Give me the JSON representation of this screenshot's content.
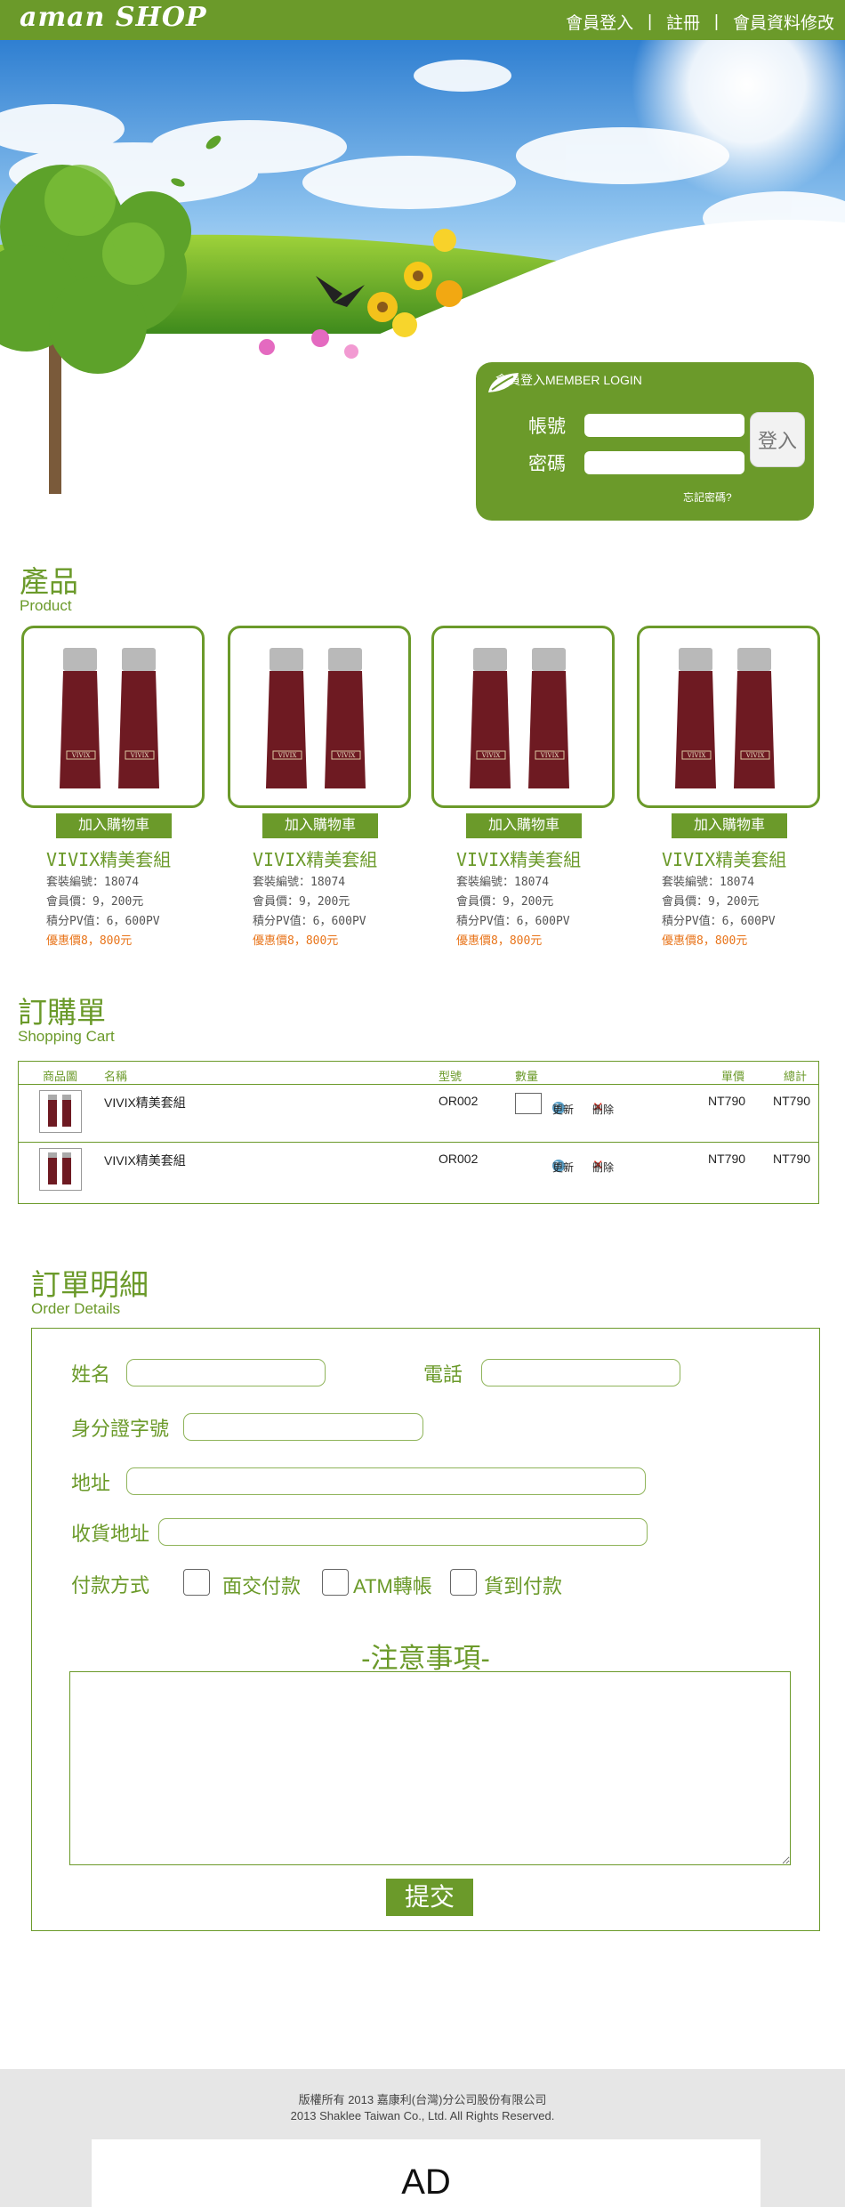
{
  "header": {
    "logo": "aman SHOP",
    "nav": [
      {
        "label": "會員登入"
      },
      {
        "label": "註冊"
      },
      {
        "label": "會員資料修改"
      }
    ],
    "separator": "|"
  },
  "login": {
    "title": "會員登入MEMBER LOGIN",
    "account_label": "帳號",
    "password_label": "密碼",
    "submit_label": "登入",
    "forgot_label": "忘記密碼?"
  },
  "products_section": {
    "title_zh": "產品",
    "title_en": "Product"
  },
  "products": [
    {
      "cart_label": "加入購物車",
      "name": "VIVIX精美套組",
      "code": "套裝編號：18074",
      "member_price": "會員價：9，200元",
      "pv": "積分PV值：6，600PV",
      "promo": "優惠價8，800元"
    },
    {
      "cart_label": "加入購物車",
      "name": "VIVIX精美套組",
      "code": "套裝編號：18074",
      "member_price": "會員價：9，200元",
      "pv": "積分PV值：6，600PV",
      "promo": "優惠價8，800元"
    },
    {
      "cart_label": "加入購物車",
      "name": "VIVIX精美套組",
      "code": "套裝編號：18074",
      "member_price": "會員價：9，200元",
      "pv": "積分PV值：6，600PV",
      "promo": "優惠價8，800元"
    },
    {
      "cart_label": "加入購物車",
      "name": "VIVIX精美套組",
      "code": "套裝編號：18074",
      "member_price": "會員價：9，200元",
      "pv": "積分PV值：6，600PV",
      "promo": "優惠價8，800元"
    }
  ],
  "cart_section": {
    "title_zh": "訂購單",
    "title_en": "Shopping Cart"
  },
  "cart": {
    "headers": {
      "image": "商品圖",
      "name": "名稱",
      "model": "型號",
      "qty": "數量",
      "unit_price": "單價",
      "total": "總計"
    },
    "rows": [
      {
        "name": "VIVIX精美套組",
        "model": "OR002",
        "update": "更新",
        "delete": "刪除",
        "unit_price": "NT790",
        "total": "NT790"
      },
      {
        "name": "VIVIX精美套組",
        "model": "OR002",
        "update": "更新",
        "delete": "刪除",
        "unit_price": "NT790",
        "total": "NT790"
      }
    ]
  },
  "order_section": {
    "title_zh": "訂單明細",
    "title_en": "Order Details"
  },
  "order": {
    "name_label": "姓名",
    "phone_label": "電話",
    "id_label": "身分證字號",
    "address_label": "地址",
    "shipping_label": "收貨地址",
    "payment_label": "付款方式",
    "payment_options": [
      "面交付款",
      "ATM轉帳",
      "貨到付款"
    ],
    "notice_title": "-注意事項-",
    "submit_label": "提交"
  },
  "footer": {
    "line1": "版權所有 2013 嘉康利(台灣)分公司股份有限公司",
    "line2": "2013 Shaklee Taiwan Co., Ltd. All Rights Reserved.",
    "ad": "AD"
  },
  "colors": {
    "brand_green": "#6b9a2a",
    "promo_orange": "#e8741a",
    "sky_blue": "#3f8fd6"
  },
  "product_image_label": "VIVIX"
}
